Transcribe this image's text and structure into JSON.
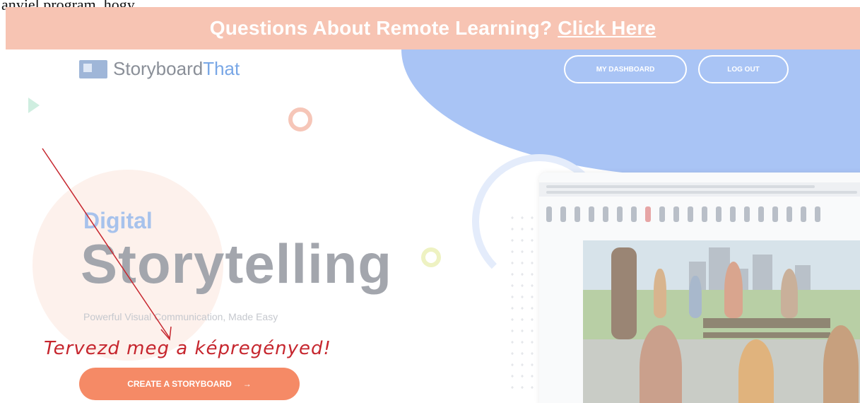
{
  "page_caption": "anyjel program, hogy",
  "banner": {
    "question": "Questions About Remote Learning?",
    "link": "Click Here"
  },
  "logo": {
    "prefix": "Storyboard",
    "suffix": "That"
  },
  "nav": {
    "dashboard": "MY DASHBOARD",
    "logout": "LOG OUT"
  },
  "hero": {
    "kicker": "Digital",
    "title": "Storytelling",
    "tagline": "Powerful Visual Communication, Made Easy"
  },
  "annotation": {
    "text": "Tervezd meg a képregényed!",
    "color": "#c6262e"
  },
  "cta": {
    "label": "CREATE A STORYBOARD",
    "arrow": "→"
  },
  "colors": {
    "banner": "#f7c4b3",
    "accent_blue": "#a9c4f5",
    "cta": "#f58a66"
  }
}
